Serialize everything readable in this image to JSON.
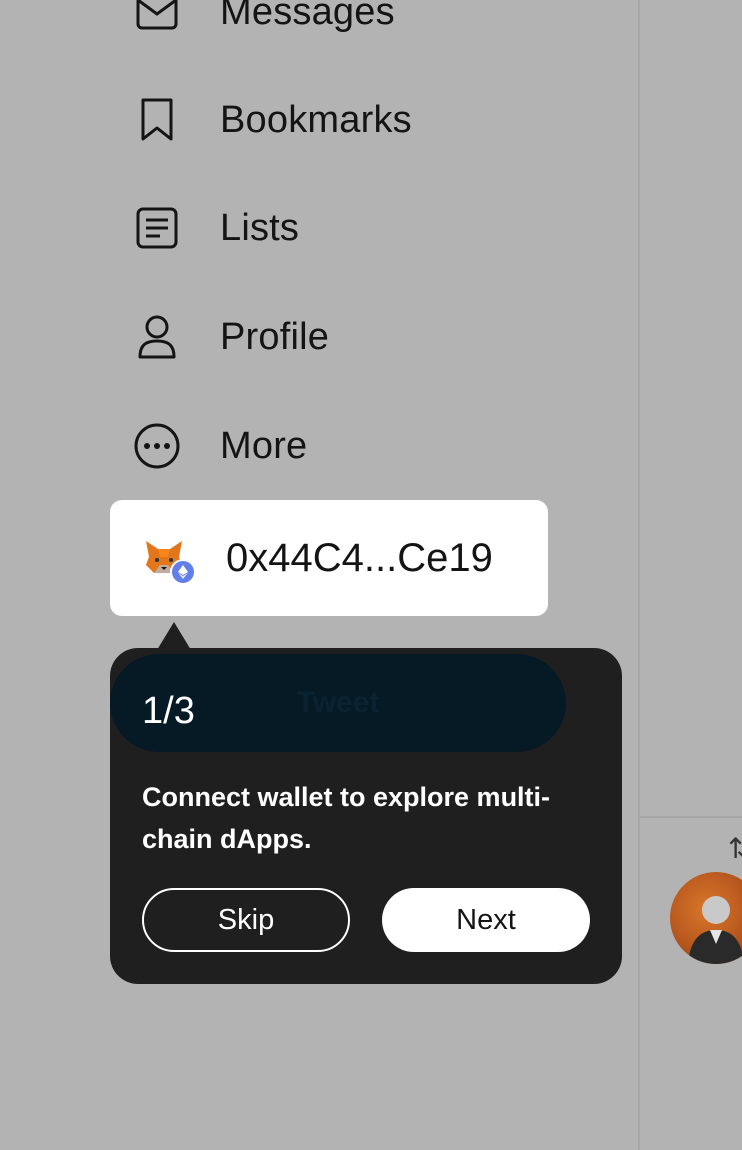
{
  "nav": {
    "items": [
      {
        "label": "Messages",
        "icon": "envelope-icon"
      },
      {
        "label": "Bookmarks",
        "icon": "bookmark-icon"
      },
      {
        "label": "Lists",
        "icon": "list-icon"
      },
      {
        "label": "Profile",
        "icon": "person-icon"
      },
      {
        "label": "More",
        "icon": "more-circle-icon"
      }
    ]
  },
  "wallet": {
    "address": "0x44C4...Ce19",
    "icon": "metamask-fox-icon",
    "network_icon": "ethereum-icon"
  },
  "tweet_button": {
    "label": "Tweet"
  },
  "onboarding": {
    "step": "1/3",
    "message": "Connect wallet to explore multi-chain dApps.",
    "skip_label": "Skip",
    "next_label": "Next"
  },
  "colors": {
    "overlay": "#b3b3b3",
    "popover": "#1f1f1f",
    "ethereum": "#627eea"
  }
}
